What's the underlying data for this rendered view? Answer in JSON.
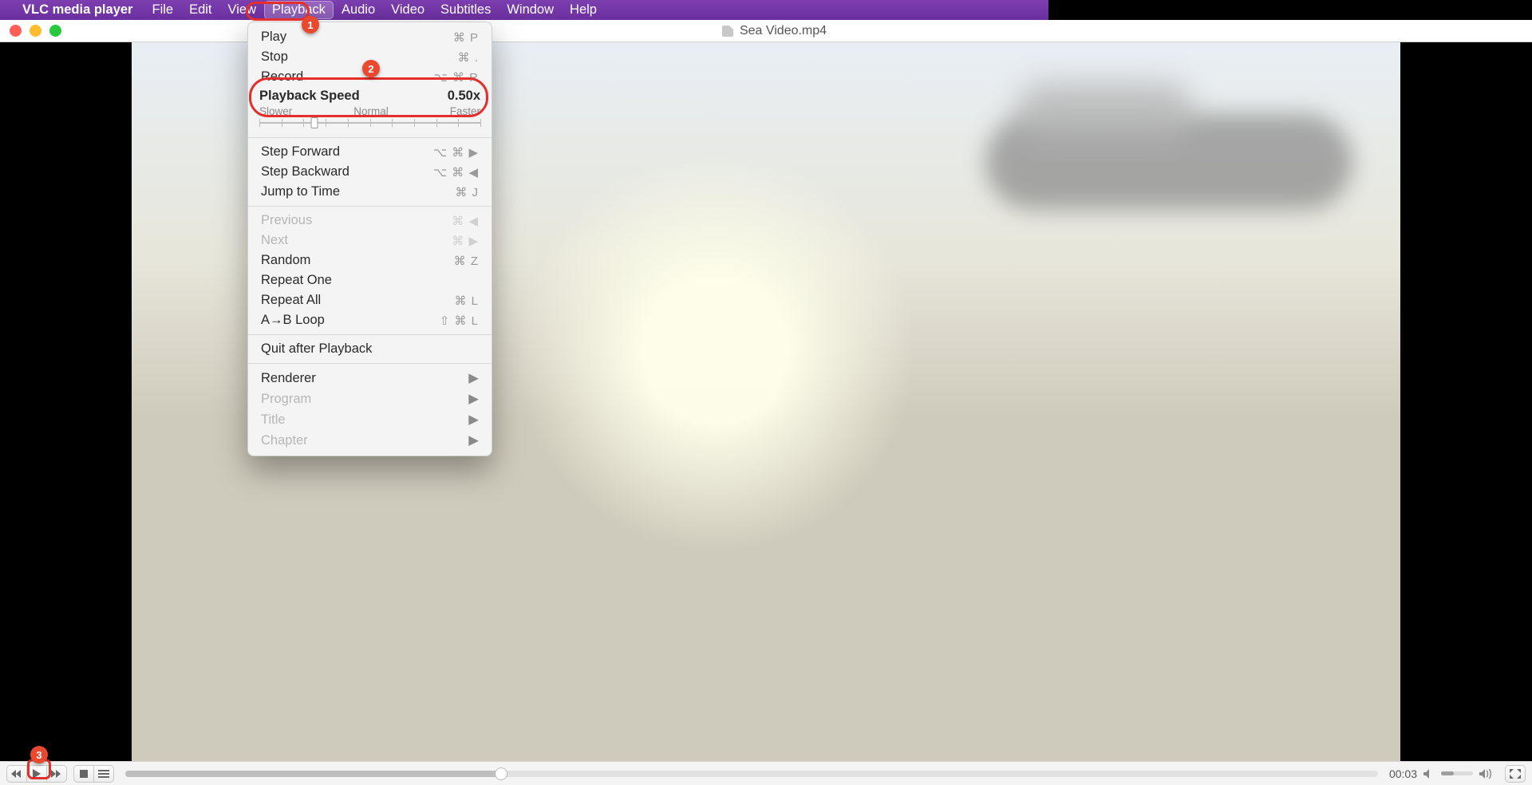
{
  "menubar": {
    "app_name": "VLC media player",
    "items": [
      {
        "label": "File"
      },
      {
        "label": "Edit"
      },
      {
        "label": "View"
      },
      {
        "label": "Playback",
        "active": true
      },
      {
        "label": "Audio"
      },
      {
        "label": "Video"
      },
      {
        "label": "Subtitles"
      },
      {
        "label": "Window"
      },
      {
        "label": "Help"
      }
    ]
  },
  "window": {
    "title": "Sea Video.mp4"
  },
  "playback_menu": {
    "play": {
      "label": "Play",
      "shortcut": "⌘ P"
    },
    "stop": {
      "label": "Stop",
      "shortcut": "⌘ ."
    },
    "record": {
      "label": "Record",
      "shortcut": "⌥ ⌘ R"
    },
    "speed": {
      "title": "Playback Speed",
      "value": "0.50x",
      "slower": "Slower",
      "normal": "Normal",
      "faster": "Faster",
      "position_pct": 25
    },
    "step_fwd": {
      "label": "Step Forward",
      "shortcut": "⌥ ⌘ ▶"
    },
    "step_back": {
      "label": "Step Backward",
      "shortcut": "⌥ ⌘ ◀"
    },
    "jump": {
      "label": "Jump to Time",
      "shortcut": "⌘ J"
    },
    "previous": {
      "label": "Previous",
      "shortcut": "⌘ ◀",
      "disabled": true
    },
    "next": {
      "label": "Next",
      "shortcut": "⌘ ▶",
      "disabled": true
    },
    "random": {
      "label": "Random",
      "shortcut": "⌘ Z"
    },
    "repeat_one": {
      "label": "Repeat One"
    },
    "repeat_all": {
      "label": "Repeat All",
      "shortcut": "⌘ L"
    },
    "ab_loop": {
      "label": "A→B Loop",
      "shortcut": "⇧ ⌘ L"
    },
    "quit_after": {
      "label": "Quit after Playback"
    },
    "renderer": {
      "label": "Renderer"
    },
    "program": {
      "label": "Program",
      "disabled": true
    },
    "title_item": {
      "label": "Title",
      "disabled": true
    },
    "chapter": {
      "label": "Chapter",
      "disabled": true
    }
  },
  "transport": {
    "time": "00:03",
    "progress_pct": 30,
    "volume_pct": 40
  },
  "annotations": {
    "badge1": "1",
    "badge2": "2",
    "badge3": "3"
  },
  "colors": {
    "menubar_purple": "#6f36a4",
    "annotation_red": "#e52f2a",
    "traffic_red": "#ff5f57",
    "traffic_yellow": "#febc2e",
    "traffic_green": "#28c840"
  }
}
